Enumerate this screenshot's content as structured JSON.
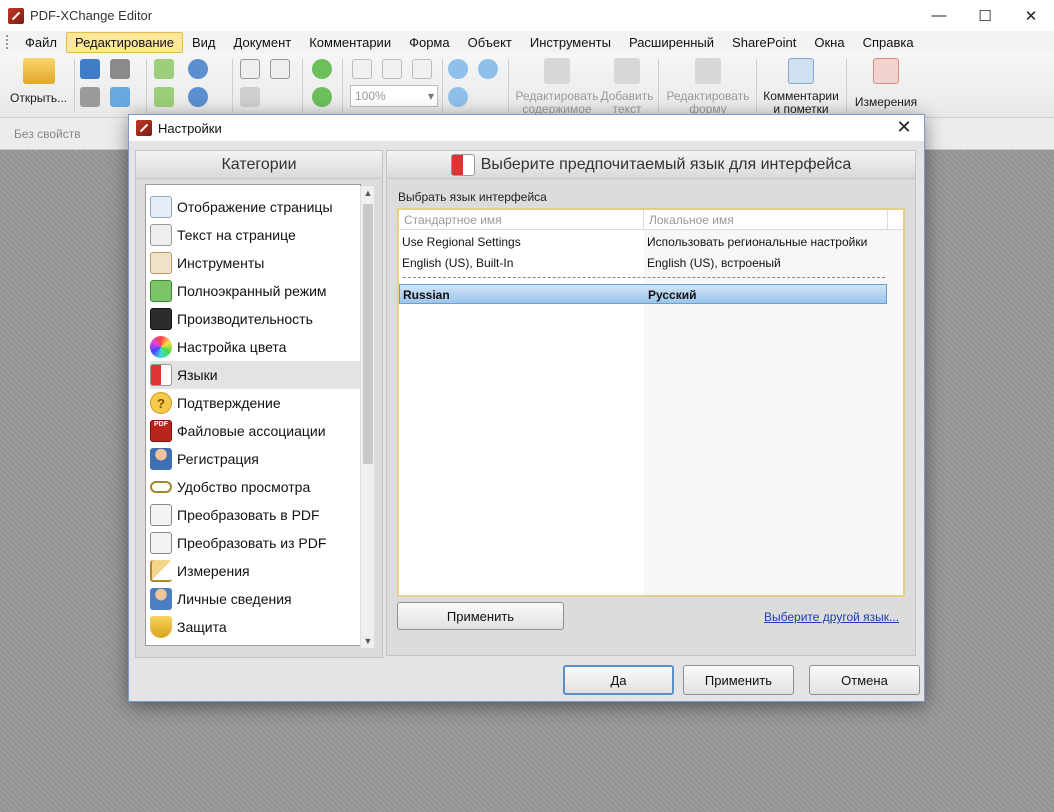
{
  "app": {
    "title": "PDF-XChange Editor",
    "controls": {
      "minimize": "—",
      "maximize": "☐",
      "close": "✕"
    }
  },
  "menu": {
    "items": [
      "Файл",
      "Редактирование",
      "Вид",
      "Документ",
      "Комментарии",
      "Форма",
      "Объект",
      "Инструменты",
      "Расширенный",
      "SharePoint",
      "Окна",
      "Справка"
    ],
    "active_index": 1
  },
  "ribbon": {
    "open": "Открыть...",
    "zoom": "100%",
    "edit_content_1": "Редактировать",
    "edit_content_2": "содержимое",
    "add_text_1": "Добавить",
    "add_text_2": "текст",
    "edit_form_1": "Редактировать",
    "edit_form_2": "форму",
    "comments_1": "Комментарии",
    "comments_2": "и пометки",
    "measure": "Измерения"
  },
  "props_bar": {
    "text": "Без свойств"
  },
  "dialog": {
    "title": "Настройки",
    "categories_header": "Категории",
    "categories": [
      {
        "label": "Отображение страницы",
        "icon": "page-view-icon"
      },
      {
        "label": "Текст на странице",
        "icon": "page-text-icon"
      },
      {
        "label": "Инструменты",
        "icon": "tools-icon"
      },
      {
        "label": "Полноэкранный режим",
        "icon": "fullscreen-icon"
      },
      {
        "label": "Производительность",
        "icon": "performance-icon"
      },
      {
        "label": "Настройка цвета",
        "icon": "color-wheel-icon"
      },
      {
        "label": "Языки",
        "icon": "languages-icon",
        "selected": true
      },
      {
        "label": "Подтверждение",
        "icon": "question-icon"
      },
      {
        "label": "Файловые ассоциации",
        "icon": "pdf-file-icon"
      },
      {
        "label": "Регистрация",
        "icon": "user-key-icon"
      },
      {
        "label": "Удобство просмотра",
        "icon": "glasses-icon"
      },
      {
        "label": "Преобразовать в PDF",
        "icon": "convert-to-pdf-icon"
      },
      {
        "label": "Преобразовать из PDF",
        "icon": "convert-from-pdf-icon"
      },
      {
        "label": "Измерения",
        "icon": "ruler-icon"
      },
      {
        "label": "Личные сведения",
        "icon": "person-icon"
      },
      {
        "label": "Защита",
        "icon": "shield-icon"
      }
    ],
    "right_header": "Выберите предпочитаемый язык для интерфейса",
    "choose_label": "Выбрать язык интерфейса",
    "table": {
      "col1": "Стандартное имя",
      "col2": "Локальное имя",
      "rows": [
        {
          "std": "Use Regional Settings",
          "local": "Использовать региональные настройки"
        },
        {
          "std": "English (US), Built-In",
          "local": "English (US), встроеный"
        },
        {
          "std": "Russian",
          "local": "Русский",
          "selected": true
        }
      ]
    },
    "apply_inner": "Применить",
    "other_lang_link": "Выберите другой язык...",
    "ok": "Да",
    "apply": "Применить",
    "cancel": "Отмена"
  },
  "colors": {
    "accent": "#5a8fc6",
    "active_menu": "#fde89a",
    "link": "#1a3fb0",
    "table_border": "#e6cf8a"
  }
}
